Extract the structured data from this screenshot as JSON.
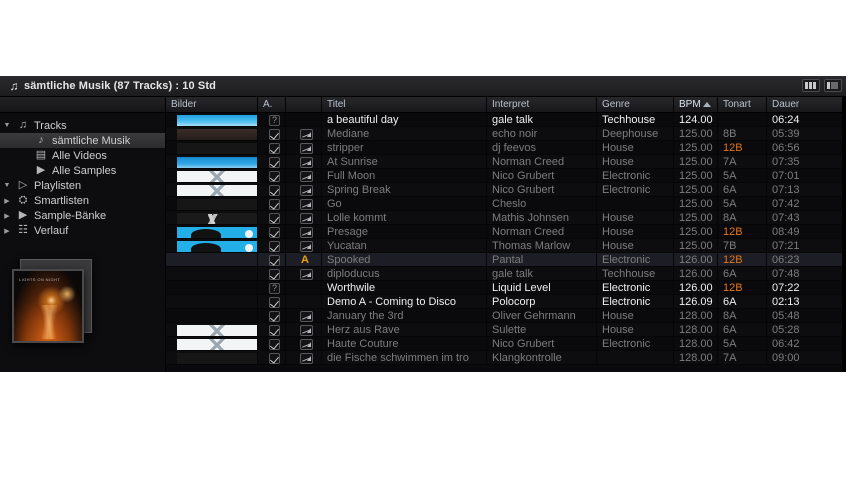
{
  "window": {
    "icon": "music-note-icon",
    "title": "sämtliche Musik (87 Tracks) : 10 Std",
    "layout_button_1": "layout-columns-icon",
    "layout_button_2": "layout-split-icon"
  },
  "sidebar": {
    "items": [
      {
        "label": "Tracks",
        "icon": "music-library-icon",
        "level": 1,
        "expanded": true,
        "selected": false
      },
      {
        "label": "sämtliche Musik",
        "icon": "music-note-icon",
        "level": 2,
        "expanded": null,
        "selected": true
      },
      {
        "label": "Alle Videos",
        "icon": "film-strip-icon",
        "level": 2,
        "expanded": null,
        "selected": false
      },
      {
        "label": "Alle Samples",
        "icon": "flag-icon",
        "level": 2,
        "expanded": null,
        "selected": false
      },
      {
        "label": "Playlisten",
        "icon": "playlist-icon",
        "level": 1,
        "expanded": true,
        "selected": false
      },
      {
        "label": "Smartlisten",
        "icon": "smartlist-icon",
        "level": 1,
        "expanded": false,
        "selected": false
      },
      {
        "label": "Sample-Bänke",
        "icon": "sample-bank-icon",
        "level": 1,
        "expanded": false,
        "selected": false
      },
      {
        "label": "Verlauf",
        "icon": "history-icon",
        "level": 1,
        "expanded": false,
        "selected": false
      }
    ]
  },
  "table": {
    "columns": [
      {
        "key": "bilder",
        "label": "Bilder",
        "sorted": false
      },
      {
        "key": "a",
        "label": "A.",
        "sorted": false
      },
      {
        "key": "wave",
        "label": "",
        "sorted": false
      },
      {
        "key": "titel",
        "label": "Titel",
        "sorted": false
      },
      {
        "key": "interpret",
        "label": "Interpret",
        "sorted": false
      },
      {
        "key": "genre",
        "label": "Genre",
        "sorted": false
      },
      {
        "key": "bpm",
        "label": "BPM",
        "sorted": true
      },
      {
        "key": "tonart",
        "label": "Tonart",
        "sorted": false
      },
      {
        "key": "dauer",
        "label": "Dauer",
        "sorted": false
      }
    ],
    "sort_direction": "ascending",
    "key_highlight_color": "#e2741a",
    "rows": [
      {
        "thumb": "t-sky",
        "check": "qmark",
        "wave": "none",
        "titel": "a beautiful day",
        "interpret": "gale talk",
        "genre": "Techhouse",
        "bpm": "124.00",
        "tonart": "",
        "dauer": "06:24",
        "bright": true,
        "selected": false,
        "key_hl": false
      },
      {
        "thumb": "t-dark",
        "check": "checked",
        "wave": "wave",
        "titel": "Mediane",
        "interpret": "echo noir",
        "genre": "Deephouse",
        "bpm": "125.00",
        "tonart": "8B",
        "dauer": "05:39",
        "bright": false,
        "selected": false,
        "key_hl": false
      },
      {
        "thumb": "t-black",
        "check": "checked",
        "wave": "wave",
        "titel": "stripper",
        "interpret": "dj feevos",
        "genre": "House",
        "bpm": "125.00",
        "tonart": "12B",
        "dauer": "06:56",
        "bright": false,
        "selected": false,
        "key_hl": true
      },
      {
        "thumb": "t-blue2",
        "check": "checked",
        "wave": "wave",
        "titel": "At Sunrise",
        "interpret": "Norman Creed",
        "genre": "House",
        "bpm": "125.00",
        "tonart": "7A",
        "dauer": "07:35",
        "bright": false,
        "selected": false,
        "key_hl": false
      },
      {
        "thumb": "t-white",
        "check": "checked",
        "wave": "wave",
        "titel": "Full Moon",
        "interpret": "Nico Grubert",
        "genre": "Electronic",
        "bpm": "125.00",
        "tonart": "5A",
        "dauer": "07:01",
        "bright": false,
        "selected": false,
        "key_hl": false
      },
      {
        "thumb": "t-white",
        "check": "checked",
        "wave": "wave",
        "titel": "Spring Break",
        "interpret": "Nico Grubert",
        "genre": "Electronic",
        "bpm": "125.00",
        "tonart": "6A",
        "dauer": "07:13",
        "bright": false,
        "selected": false,
        "key_hl": false
      },
      {
        "thumb": "t-black",
        "check": "checked",
        "wave": "wave",
        "titel": "Go",
        "interpret": "Cheslo",
        "genre": "",
        "bpm": "125.00",
        "tonart": "5A",
        "dauer": "07:42",
        "bright": false,
        "selected": false,
        "key_hl": false
      },
      {
        "thumb": "t-sketch",
        "check": "checked",
        "wave": "wave",
        "titel": "Lolle kommt",
        "interpret": "Mathis Johnsen",
        "genre": "House",
        "bpm": "125.00",
        "tonart": "8A",
        "dauer": "07:43",
        "bright": false,
        "selected": false,
        "key_hl": false
      },
      {
        "thumb": "t-toon",
        "check": "checked",
        "wave": "wave",
        "titel": "Presage",
        "interpret": "Norman Creed",
        "genre": "House",
        "bpm": "125.00",
        "tonart": "12B",
        "dauer": "08:49",
        "bright": false,
        "selected": false,
        "key_hl": true
      },
      {
        "thumb": "t-toon",
        "check": "checked",
        "wave": "wave",
        "titel": "Yucatan",
        "interpret": "Thomas Marlow",
        "genre": "House",
        "bpm": "125.00",
        "tonart": "7B",
        "dauer": "07:21",
        "bright": false,
        "selected": false,
        "key_hl": false
      },
      {
        "thumb": "t-none",
        "check": "checked",
        "wave": "amark",
        "titel": "Spooked",
        "interpret": "Pantal",
        "genre": "Electronic",
        "bpm": "126.00",
        "tonart": "12B",
        "dauer": "06:23",
        "bright": false,
        "selected": true,
        "key_hl": true
      },
      {
        "thumb": "t-none",
        "check": "checked",
        "wave": "wave",
        "titel": "diploducus",
        "interpret": "gale talk",
        "genre": "Techhouse",
        "bpm": "126.00",
        "tonart": "6A",
        "dauer": "07:48",
        "bright": false,
        "selected": false,
        "key_hl": false
      },
      {
        "thumb": "t-none",
        "check": "qmark",
        "wave": "none",
        "titel": "Worthwile",
        "interpret": "Liquid Level",
        "genre": "Electronic",
        "bpm": "126.00",
        "tonart": "12B",
        "dauer": "07:22",
        "bright": true,
        "selected": false,
        "key_hl": true
      },
      {
        "thumb": "t-none",
        "check": "checked",
        "wave": "none",
        "titel": "Demo A - Coming to Disco",
        "interpret": "Polocorp",
        "genre": "Electronic",
        "bpm": "126.09",
        "tonart": "6A",
        "dauer": "02:13",
        "bright": true,
        "selected": false,
        "key_hl": false
      },
      {
        "thumb": "t-none",
        "check": "checked",
        "wave": "wave",
        "titel": "January the 3rd",
        "interpret": "Oliver Gehrmann",
        "genre": "House",
        "bpm": "128.00",
        "tonart": "8A",
        "dauer": "05:48",
        "bright": false,
        "selected": false,
        "key_hl": false
      },
      {
        "thumb": "t-white",
        "check": "checked",
        "wave": "wave",
        "titel": "Herz aus Rave",
        "interpret": "Sulette",
        "genre": "House",
        "bpm": "128.00",
        "tonart": "6A",
        "dauer": "05:28",
        "bright": false,
        "selected": false,
        "key_hl": false
      },
      {
        "thumb": "t-white",
        "check": "checked",
        "wave": "wave",
        "titel": "Haute Couture",
        "interpret": "Nico Grubert",
        "genre": "Electronic",
        "bpm": "128.00",
        "tonart": "5A",
        "dauer": "06:42",
        "bright": false,
        "selected": false,
        "key_hl": false
      },
      {
        "thumb": "t-black",
        "check": "checked",
        "wave": "wave",
        "titel": "die Fische schwimmen im tro",
        "interpret": "Klangkontrolle",
        "genre": "",
        "bpm": "128.00",
        "tonart": "7A",
        "dauer": "09:00",
        "bright": false,
        "selected": false,
        "key_hl": false
      }
    ]
  },
  "album_art_popup": {
    "name": "album-art-preview",
    "caption": "LIGHTS ON NIGHT"
  }
}
